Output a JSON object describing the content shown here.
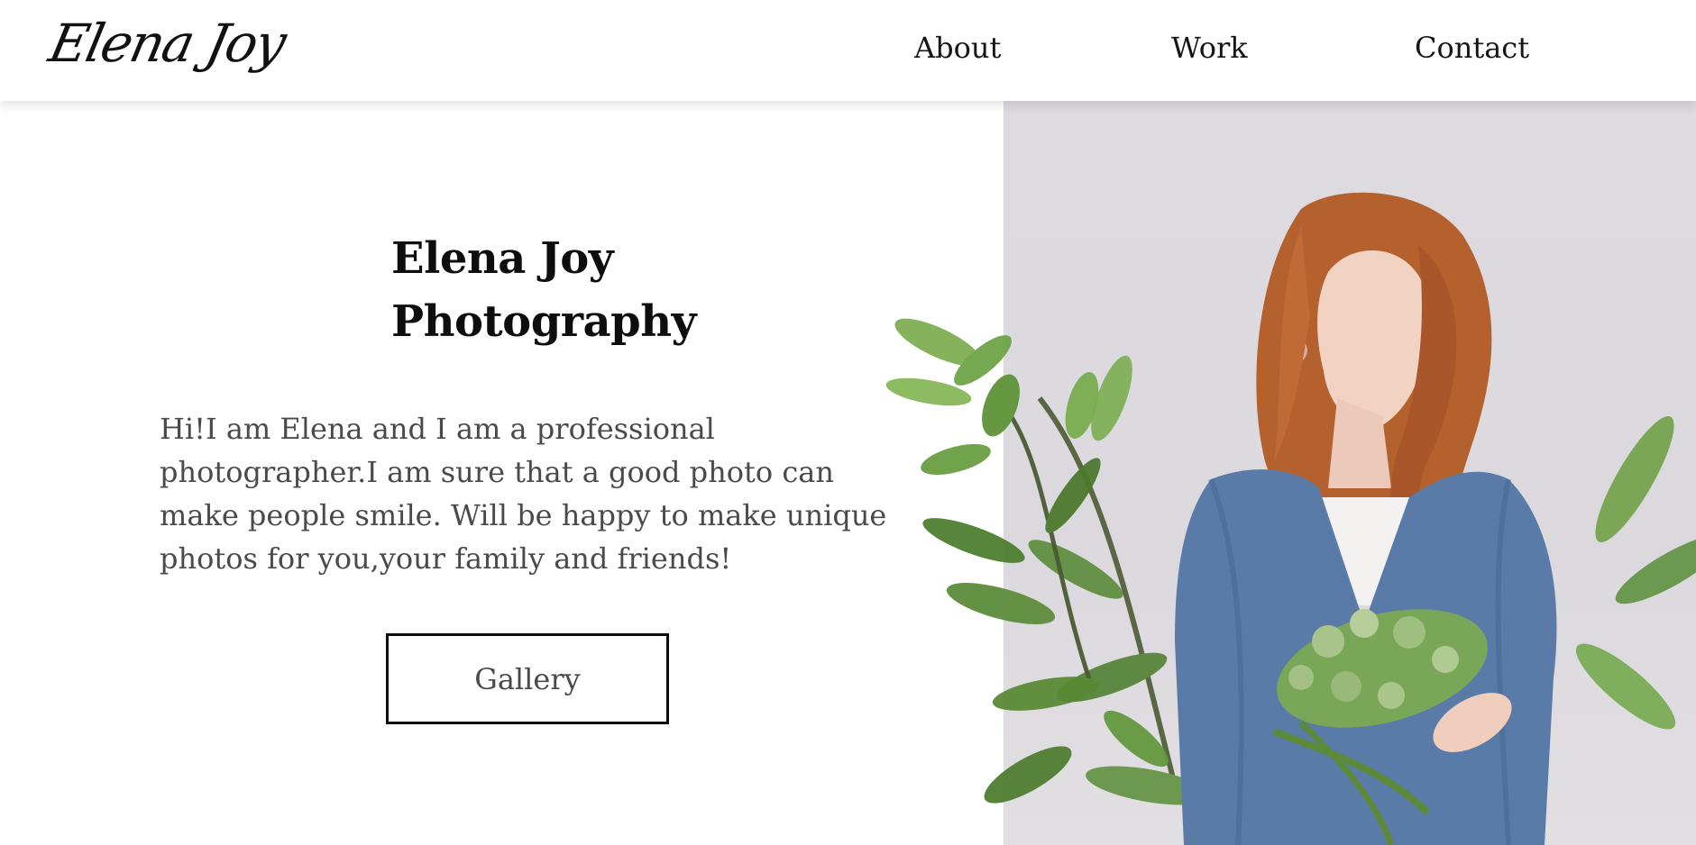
{
  "header": {
    "logo": "Elena Joy",
    "nav": {
      "about": "About",
      "work": "Work",
      "contact": "Contact"
    }
  },
  "hero": {
    "title_line1": "Elena Joy",
    "title_line2": "Photography",
    "text_lines": [
      "Hi!I am Elena and I am a professional",
      "photographer.I am sure that a good photo can",
      "make people smile. Will be happy to make unique",
      "photos for you,your family and friends!"
    ],
    "button_label": "Gallery"
  },
  "colors": {
    "background": "#ffffff",
    "text_dark": "#0d0d0d",
    "text_muted": "#4a4a4a",
    "photo_backdrop": "#dcd9de",
    "hair": "#b5612e",
    "sweater": "#5a7aa8",
    "leaf": "#6f9e45"
  },
  "icons": {
    "hero_image": "woman-with-flowers-photo"
  }
}
